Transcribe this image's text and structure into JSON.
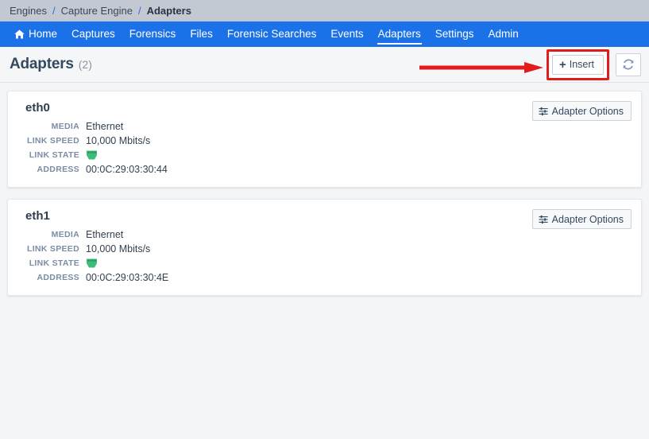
{
  "breadcrumb": {
    "separator": "/",
    "items": [
      {
        "label": "Engines",
        "current": false
      },
      {
        "label": "Capture Engine",
        "current": false
      },
      {
        "label": "Adapters",
        "current": true
      }
    ]
  },
  "nav": {
    "items": [
      {
        "label": "Home",
        "icon": "home-icon",
        "active": false
      },
      {
        "label": "Captures",
        "active": false
      },
      {
        "label": "Forensics",
        "active": false
      },
      {
        "label": "Files",
        "active": false
      },
      {
        "label": "Forensic Searches",
        "active": false
      },
      {
        "label": "Events",
        "active": false
      },
      {
        "label": "Adapters",
        "active": true
      },
      {
        "label": "Settings",
        "active": false
      },
      {
        "label": "Admin",
        "active": false
      }
    ]
  },
  "toolbar": {
    "title": "Adapters",
    "count": "(2)",
    "insert_label": "Insert",
    "insert_plus": "+",
    "refresh_icon": "refresh-icon",
    "insert_highlight_color": "#e21b1b"
  },
  "annotation": {
    "arrow_color": "#e21b1b",
    "arrow_points_to": "Insert"
  },
  "adapters": [
    {
      "name": "eth0",
      "options_label": "Adapter Options",
      "props": [
        {
          "label": "MEDIA",
          "value": "Ethernet",
          "type": "text"
        },
        {
          "label": "LINK SPEED",
          "value": "10,000 Mbits/s",
          "type": "text"
        },
        {
          "label": "LINK STATE",
          "value": "link-up-port-icon",
          "type": "icon"
        },
        {
          "label": "ADDRESS",
          "value": "00:0C:29:03:30:44",
          "type": "text"
        }
      ]
    },
    {
      "name": "eth1",
      "options_label": "Adapter Options",
      "props": [
        {
          "label": "MEDIA",
          "value": "Ethernet",
          "type": "text"
        },
        {
          "label": "LINK SPEED",
          "value": "10,000 Mbits/s",
          "type": "text"
        },
        {
          "label": "LINK STATE",
          "value": "link-up-port-icon",
          "type": "icon"
        },
        {
          "label": "ADDRESS",
          "value": "00:0C:29:03:30:4E",
          "type": "text"
        }
      ]
    }
  ],
  "colors": {
    "nav_blue": "#1b72e8",
    "breadcrumb_gray": "#c3c9d3",
    "page_bg": "#f4f5f7",
    "link_state_green": "#3dbd78",
    "label_gray": "#7b8ca5"
  }
}
